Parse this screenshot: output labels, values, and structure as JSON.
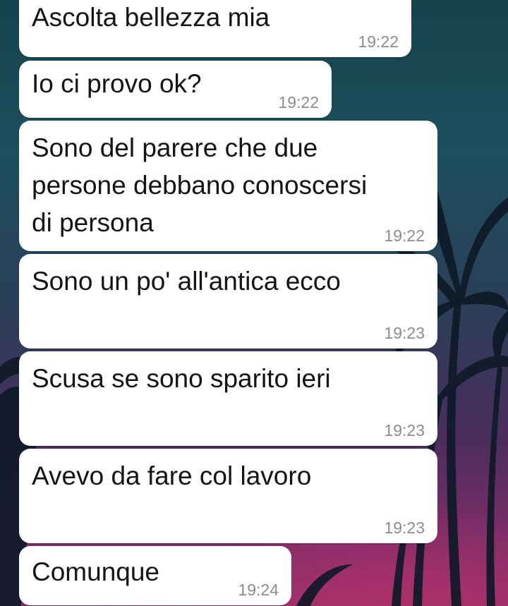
{
  "chat": {
    "messages": [
      {
        "text": "Ascolta bellezza mia",
        "time": "19:22"
      },
      {
        "text": "Io ci provo ok?",
        "time": "19:22"
      },
      {
        "text": "Sono del parere che due\npersone debbano conoscersi\ndi persona",
        "time": "19:22"
      },
      {
        "text": "Sono un po' all'antica ecco",
        "time": "19:23"
      },
      {
        "text": "Scusa se sono sparito ieri",
        "time": "19:23"
      },
      {
        "text": "Avevo da fare col lavoro",
        "time": "19:23"
      },
      {
        "text": "Comunque",
        "time": "19:24"
      }
    ]
  },
  "wallpaper": {
    "top_color": "#16424e",
    "bottom_color": "#9a2f6a",
    "silhouette_color": "#0f1a28"
  }
}
